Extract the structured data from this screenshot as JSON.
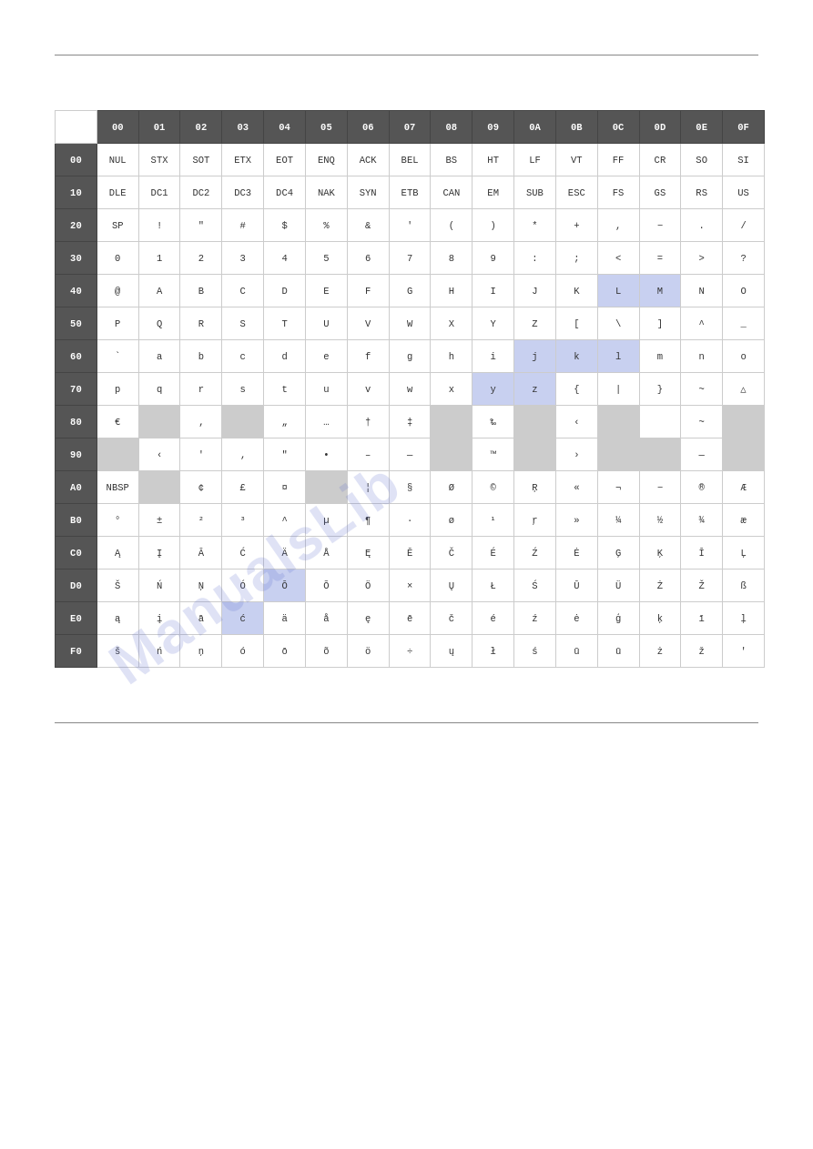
{
  "table": {
    "col_headers": [
      "",
      "00",
      "01",
      "02",
      "03",
      "04",
      "05",
      "06",
      "07",
      "08",
      "09",
      "0A",
      "0B",
      "0C",
      "0D",
      "0E",
      "0F"
    ],
    "rows": [
      {
        "header": "00",
        "cells": [
          "NUL",
          "STX",
          "SOT",
          "ETX",
          "EOT",
          "ENQ",
          "ACK",
          "BEL",
          "BS",
          "HT",
          "LF",
          "VT",
          "FF",
          "CR",
          "SO",
          "SI"
        ],
        "types": [
          "n",
          "n",
          "n",
          "n",
          "n",
          "n",
          "n",
          "n",
          "n",
          "n",
          "n",
          "n",
          "n",
          "n",
          "n",
          "n"
        ]
      },
      {
        "header": "10",
        "cells": [
          "DLE",
          "DC1",
          "DC2",
          "DC3",
          "DC4",
          "NAK",
          "SYN",
          "ETB",
          "CAN",
          "EM",
          "SUB",
          "ESC",
          "FS",
          "GS",
          "RS",
          "US"
        ],
        "types": [
          "n",
          "n",
          "n",
          "n",
          "n",
          "n",
          "n",
          "n",
          "n",
          "n",
          "n",
          "n",
          "n",
          "n",
          "n",
          "n"
        ]
      },
      {
        "header": "20",
        "cells": [
          "SP",
          "!",
          "\"",
          "#",
          "$",
          "%",
          "&",
          "'",
          "(",
          ")",
          "*",
          "+",
          ",",
          "−",
          ".",
          "/"
        ],
        "types": [
          "n",
          "n",
          "n",
          "n",
          "n",
          "n",
          "n",
          "n",
          "n",
          "n",
          "n",
          "n",
          "n",
          "n",
          "n",
          "n"
        ]
      },
      {
        "header": "30",
        "cells": [
          "0",
          "1",
          "2",
          "3",
          "4",
          "5",
          "6",
          "7",
          "8",
          "9",
          ":",
          ";",
          "<",
          "=",
          ">",
          "?"
        ],
        "types": [
          "n",
          "n",
          "n",
          "n",
          "n",
          "n",
          "n",
          "n",
          "n",
          "n",
          "n",
          "n",
          "n",
          "n",
          "n",
          "n"
        ]
      },
      {
        "header": "40",
        "cells": [
          "@",
          "A",
          "B",
          "C",
          "D",
          "E",
          "F",
          "G",
          "H",
          "I",
          "J",
          "K",
          "L",
          "M",
          "N",
          "O"
        ],
        "types": [
          "n",
          "n",
          "n",
          "n",
          "n",
          "n",
          "n",
          "n",
          "n",
          "n",
          "n",
          "n",
          "h",
          "h",
          "n",
          "n"
        ]
      },
      {
        "header": "50",
        "cells": [
          "P",
          "Q",
          "R",
          "S",
          "T",
          "U",
          "V",
          "W",
          "X",
          "Y",
          "Z",
          "[",
          "\\",
          "]",
          "^",
          "_"
        ],
        "types": [
          "n",
          "n",
          "n",
          "n",
          "n",
          "n",
          "n",
          "n",
          "n",
          "n",
          "n",
          "n",
          "n",
          "n",
          "n",
          "n"
        ]
      },
      {
        "header": "60",
        "cells": [
          "`",
          "a",
          "b",
          "c",
          "d",
          "e",
          "f",
          "g",
          "h",
          "i",
          "j",
          "k",
          "l",
          "m",
          "n",
          "o"
        ],
        "types": [
          "n",
          "n",
          "n",
          "n",
          "n",
          "n",
          "n",
          "n",
          "n",
          "n",
          "h",
          "h",
          "h",
          "n",
          "n",
          "n"
        ]
      },
      {
        "header": "70",
        "cells": [
          "p",
          "q",
          "r",
          "s",
          "t",
          "u",
          "v",
          "w",
          "x",
          "y",
          "z",
          "{",
          "|",
          "}",
          "~",
          "△"
        ],
        "types": [
          "n",
          "n",
          "n",
          "n",
          "n",
          "n",
          "n",
          "n",
          "n",
          "h",
          "h",
          "n",
          "n",
          "n",
          "n",
          "n"
        ]
      },
      {
        "header": "80",
        "cells": [
          "€",
          "",
          "‚",
          "",
          "„",
          "…",
          "†",
          "‡",
          "",
          "‰",
          "",
          "‹",
          "",
          "",
          "~",
          ""
        ],
        "types": [
          "n",
          "g",
          "n",
          "g",
          "n",
          "n",
          "n",
          "n",
          "g",
          "n",
          "g",
          "n",
          "g",
          "n",
          "n",
          "g"
        ]
      },
      {
        "header": "90",
        "cells": [
          "",
          "‹",
          "'",
          "‚",
          "\"",
          "•",
          "–",
          "—",
          "",
          "™",
          "",
          "›",
          "",
          "",
          "—",
          ""
        ],
        "types": [
          "g",
          "n",
          "n",
          "n",
          "n",
          "n",
          "n",
          "n",
          "g",
          "n",
          "g",
          "n",
          "g",
          "g",
          "n",
          "g"
        ]
      },
      {
        "header": "A0",
        "cells": [
          "NBSP",
          "",
          "¢",
          "£",
          "¤",
          "",
          "¦",
          "§",
          "Ø",
          "©",
          "Ŗ",
          "«",
          "¬",
          "−",
          "®",
          "Æ"
        ],
        "types": [
          "n",
          "g",
          "n",
          "n",
          "n",
          "g",
          "n",
          "n",
          "n",
          "n",
          "n",
          "n",
          "n",
          "n",
          "n",
          "n"
        ]
      },
      {
        "header": "B0",
        "cells": [
          "°",
          "±",
          "²",
          "³",
          "^",
          "µ",
          "¶",
          "·",
          "ø",
          "¹",
          "ŗ",
          "»",
          "¼",
          "½",
          "¾",
          "æ"
        ],
        "types": [
          "n",
          "n",
          "n",
          "n",
          "n",
          "n",
          "n",
          "n",
          "n",
          "n",
          "n",
          "n",
          "n",
          "n",
          "n",
          "n"
        ]
      },
      {
        "header": "C0",
        "cells": [
          "Ą",
          "Į",
          "Ā",
          "Ć",
          "Ä",
          "Å",
          "Ę",
          "Ē",
          "Č",
          "É",
          "Ź",
          "Ė",
          "Ģ",
          "Ķ",
          "Ī",
          "Ļ"
        ],
        "types": [
          "n",
          "n",
          "n",
          "n",
          "n",
          "n",
          "n",
          "n",
          "n",
          "n",
          "n",
          "n",
          "n",
          "n",
          "n",
          "n"
        ]
      },
      {
        "header": "D0",
        "cells": [
          "Š",
          "Ń",
          "Ņ",
          "Ó",
          "Ō",
          "Õ",
          "Ö",
          "×",
          "Ų",
          "Ł",
          "Ś",
          "Ū",
          "Ü",
          "Ż",
          "Ž",
          "ß"
        ],
        "types": [
          "n",
          "n",
          "n",
          "n",
          "h",
          "n",
          "n",
          "n",
          "n",
          "n",
          "n",
          "n",
          "n",
          "n",
          "n",
          "n"
        ]
      },
      {
        "header": "E0",
        "cells": [
          "ą",
          "į",
          "ā",
          "ć",
          "ä",
          "å",
          "ę",
          "ē",
          "č",
          "é",
          "ź",
          "ė",
          "ģ",
          "ķ",
          "ī",
          "ļ"
        ],
        "types": [
          "n",
          "n",
          "n",
          "h",
          "n",
          "n",
          "n",
          "n",
          "n",
          "n",
          "n",
          "n",
          "n",
          "n",
          "n",
          "n"
        ]
      },
      {
        "header": "F0",
        "cells": [
          "š",
          "ń",
          "ņ",
          "ó",
          "ō",
          "õ",
          "ö",
          "÷",
          "ų",
          "ł",
          "ś",
          "ū",
          "ū",
          "ż",
          "ž",
          "'"
        ],
        "types": [
          "n",
          "n",
          "n",
          "n",
          "n",
          "n",
          "n",
          "n",
          "n",
          "n",
          "n",
          "n",
          "n",
          "n",
          "n",
          "n"
        ]
      }
    ]
  },
  "watermark": "manualslib"
}
